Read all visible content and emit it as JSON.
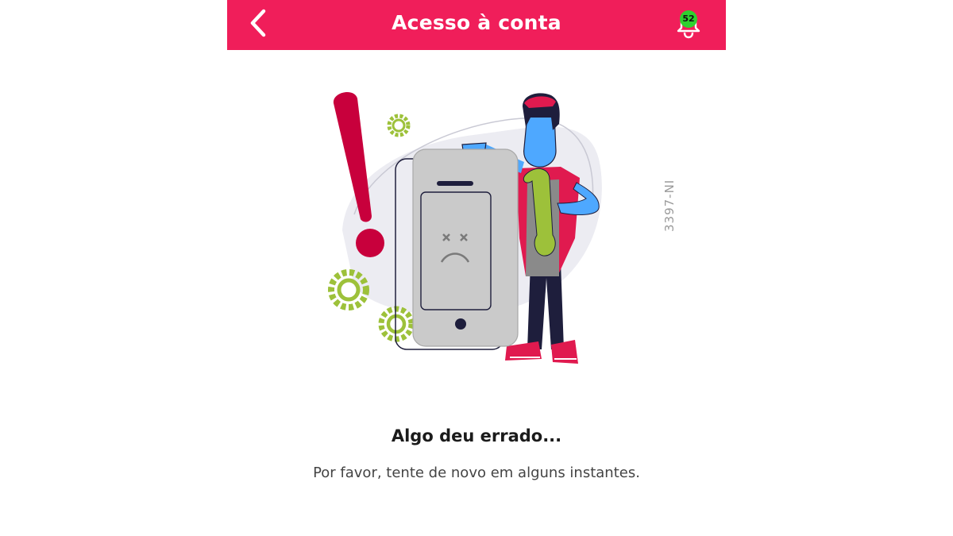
{
  "header": {
    "title": "Acesso à conta",
    "background_color": "#f01e5a",
    "back_icon": "chevron-left-icon",
    "notifications": {
      "icon": "bell-icon",
      "count": "52",
      "badge_color": "#2fd02f"
    }
  },
  "illustration": {
    "side_code": "3397-NI",
    "accent_color": "#c8003c",
    "gear_color": "#9dc13a"
  },
  "error": {
    "title": "Algo deu errado...",
    "message": "Por favor, tente de novo em alguns instantes."
  }
}
